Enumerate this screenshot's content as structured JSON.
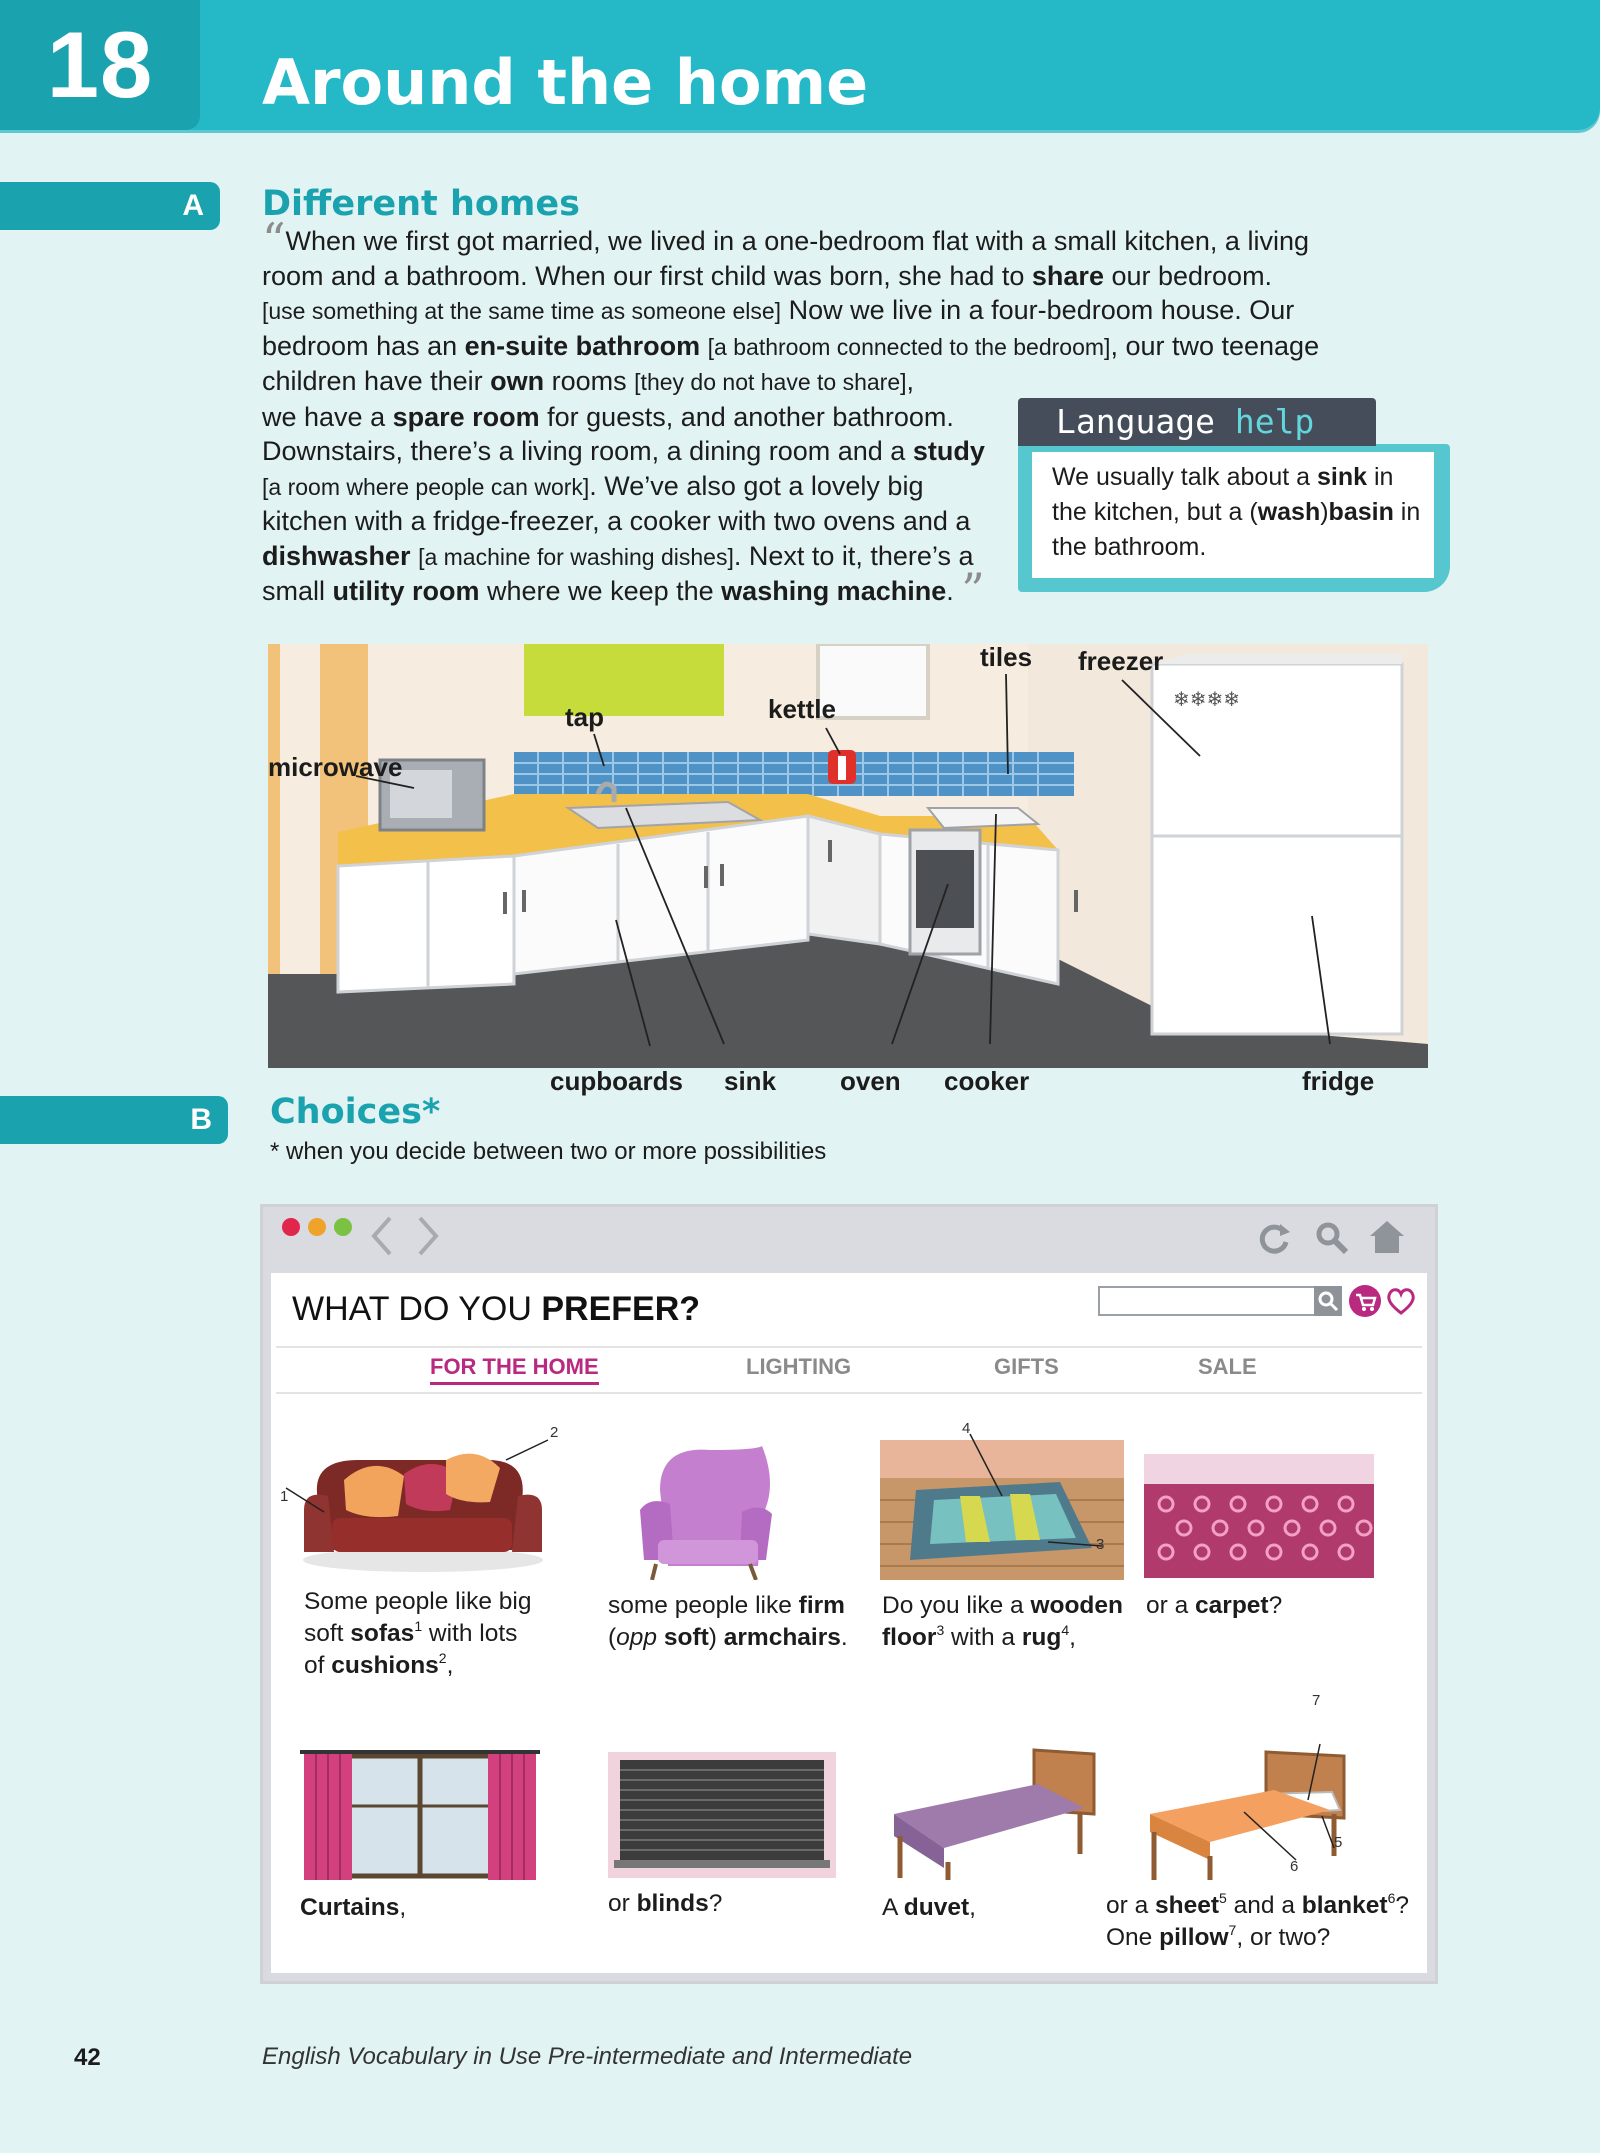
{
  "header": {
    "unit_number": "18",
    "title": "Around the home"
  },
  "section_a": {
    "letter": "A",
    "title": "Different homes",
    "language_help": {
      "label_1": "Language",
      "label_2": "help",
      "text": "We usually talk about a sink in the kitchen, but a (wash)basin in the bathroom."
    }
  },
  "kitchen_labels": [
    "microwave",
    "tap",
    "kettle",
    "tiles",
    "freezer",
    "cupboards",
    "sink",
    "oven",
    "cooker",
    "fridge"
  ],
  "section_b": {
    "letter": "B",
    "title": "Choices*",
    "note": "* when you decide between two or more possibilities"
  },
  "website": {
    "title_1": "WHAT DO YOU",
    "title_2": "PREFER?",
    "nav": [
      "FOR THE HOME",
      "LIGHTING",
      "GIFTS",
      "SALE"
    ],
    "active_nav": "FOR THE HOME"
  },
  "footer": {
    "page_number": "42",
    "book_title": "English Vocabulary in Use Pre-intermediate and Intermediate"
  }
}
